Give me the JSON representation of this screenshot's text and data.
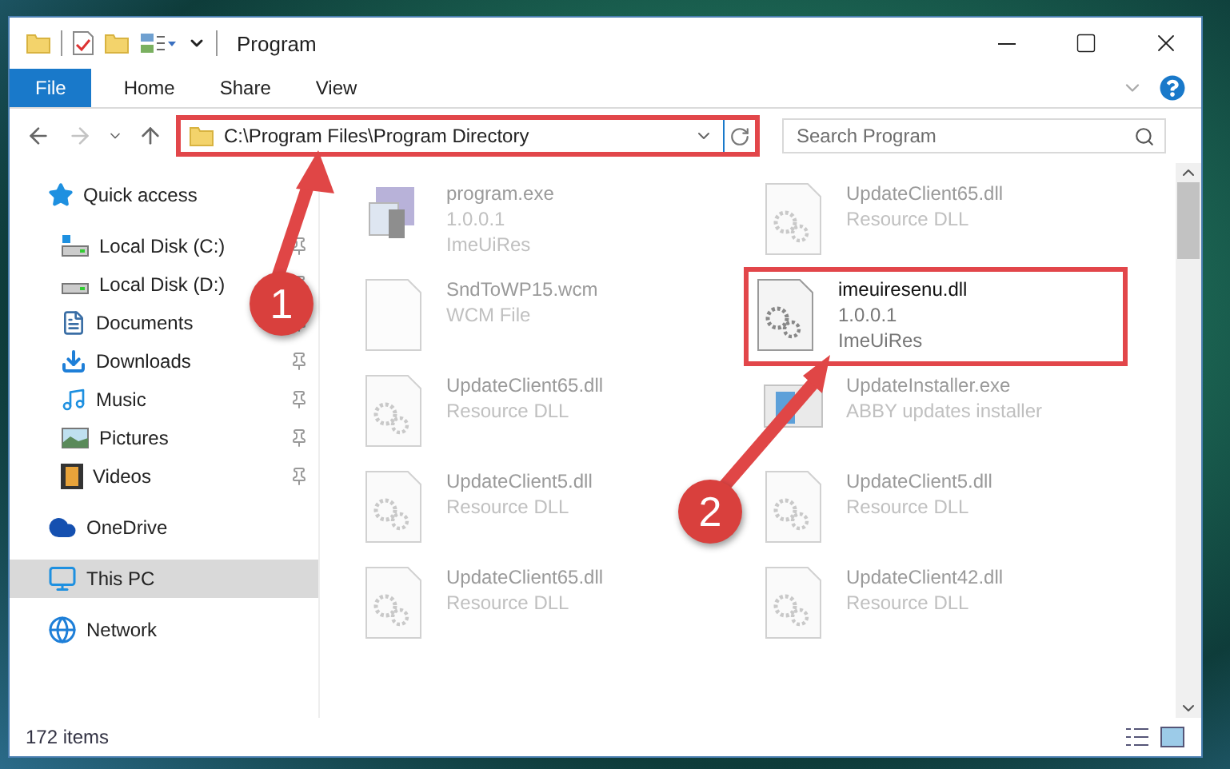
{
  "window": {
    "title": "Program"
  },
  "ribbon_tabs": [
    {
      "label": "File",
      "selected": true
    },
    {
      "label": "Home",
      "selected": false
    },
    {
      "label": "Share",
      "selected": false
    },
    {
      "label": "View",
      "selected": false
    }
  ],
  "address_bar": {
    "path": "C:\\Program Files\\Program Directory",
    "highlighted": true
  },
  "search": {
    "placeholder": "Search Program"
  },
  "sidebar": {
    "items": [
      {
        "label": "Quick access",
        "kind": "star",
        "selected": false,
        "children": [
          {
            "label": "Local Disk (C:)",
            "kind": "drive-c",
            "pinned": true,
            "selected": false
          },
          {
            "label": "Local Disk (D:)",
            "kind": "drive",
            "pinned": true,
            "selected": false
          },
          {
            "label": "Documents",
            "kind": "documents",
            "pinned": true,
            "selected": false
          },
          {
            "label": "Downloads",
            "kind": "downloads",
            "pinned": true,
            "selected": false
          },
          {
            "label": "Music",
            "kind": "music",
            "pinned": true,
            "selected": false
          },
          {
            "label": "Pictures",
            "kind": "pictures",
            "pinned": true,
            "selected": false
          },
          {
            "label": "Videos",
            "kind": "videos",
            "pinned": true,
            "selected": false
          }
        ]
      },
      {
        "label": "OneDrive",
        "kind": "cloud",
        "selected": false
      },
      {
        "label": "This PC",
        "kind": "pc",
        "selected": true
      },
      {
        "label": "Network",
        "kind": "network",
        "selected": false
      }
    ]
  },
  "files": [
    {
      "name": "program.exe",
      "details": [
        "1.0.0.1",
        "ImeUiRes"
      ],
      "kind": "exe",
      "dimmed": true,
      "highlighted": false
    },
    {
      "name": "UpdateClient65.dll",
      "details": [
        "Resource DLL"
      ],
      "kind": "dll",
      "dimmed": true,
      "highlighted": false
    },
    {
      "name": "SndToWP15.wcm",
      "details": [
        "WCM File"
      ],
      "kind": "file",
      "dimmed": true,
      "highlighted": false
    },
    {
      "name": "imeuiresenu.dll",
      "details": [
        "1.0.0.1",
        "ImeUiRes"
      ],
      "kind": "dll",
      "dimmed": false,
      "highlighted": true
    },
    {
      "name": "UpdateClient65.dll",
      "details": [
        "Resource DLL"
      ],
      "kind": "dll",
      "dimmed": true,
      "highlighted": false
    },
    {
      "name": "UpdateInstaller.exe",
      "details": [
        "ABBY updates installer"
      ],
      "kind": "installer",
      "dimmed": true,
      "highlighted": false
    },
    {
      "name": "UpdateClient5.dll",
      "details": [
        "Resource DLL"
      ],
      "kind": "dll",
      "dimmed": true,
      "highlighted": false
    },
    {
      "name": "UpdateClient5.dll",
      "details": [
        "Resource DLL"
      ],
      "kind": "dll",
      "dimmed": true,
      "highlighted": false
    },
    {
      "name": "UpdateClient65.dll",
      "details": [
        "Resource DLL"
      ],
      "kind": "dll",
      "dimmed": true,
      "highlighted": false
    },
    {
      "name": "UpdateClient42.dll",
      "details": [
        "Resource DLL"
      ],
      "kind": "dll",
      "dimmed": true,
      "highlighted": false
    }
  ],
  "status_bar": {
    "item_count": "172 items"
  },
  "annotations": [
    {
      "label": "1"
    },
    {
      "label": "2"
    }
  ]
}
